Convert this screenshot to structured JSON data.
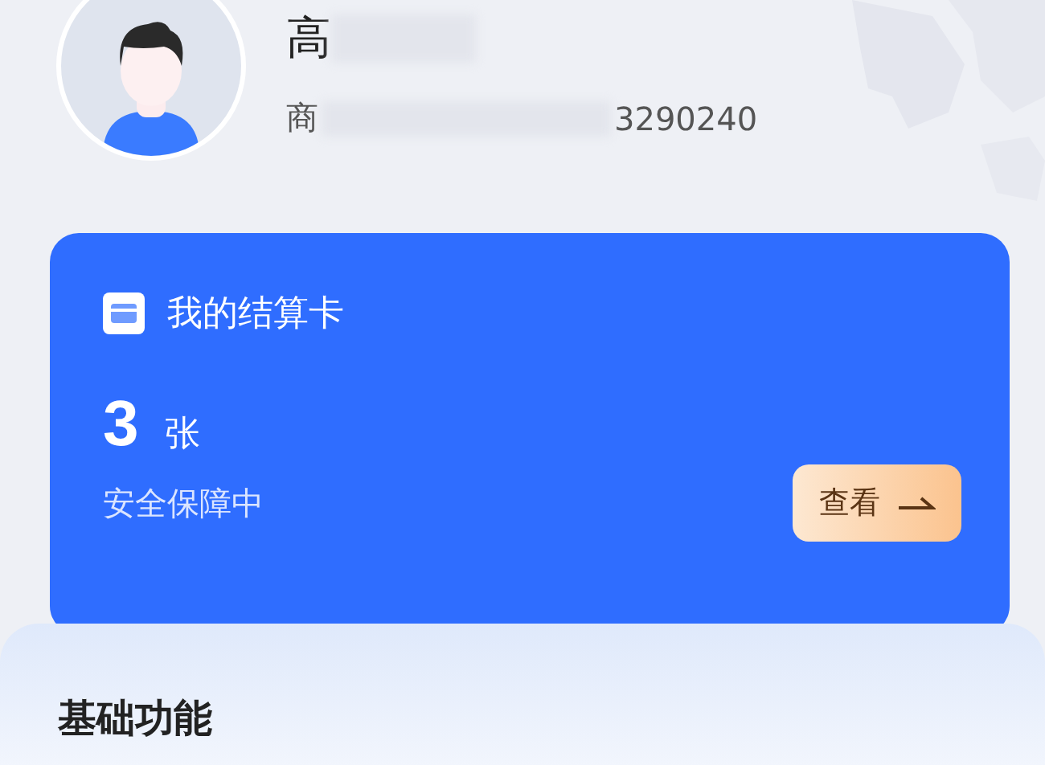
{
  "profile": {
    "name": "高",
    "merchant_prefix": "商",
    "merchant_suffix": "3290240"
  },
  "card": {
    "title": "我的结算卡",
    "count": "3",
    "unit": "张",
    "status": "安全保障中",
    "button": "查看"
  },
  "section": {
    "title": "基础功能"
  }
}
